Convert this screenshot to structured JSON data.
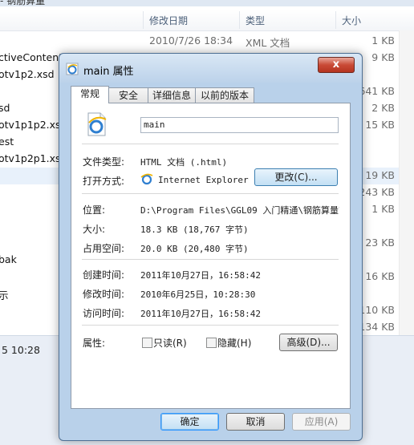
{
  "explorer": {
    "topbar_text": "- 钢筋算量",
    "columns": {
      "modified": "修改日期",
      "type": "类型",
      "size": "大小"
    },
    "files": [
      {
        "name": "",
        "modified": "2010/7/26 18:34",
        "type": "XML 文档",
        "size": "1 KB"
      },
      {
        "name": "ctiveContent",
        "modified": "",
        "type": "",
        "size": "9 KB"
      },
      {
        "name": "otv1p2.xsd",
        "modified": "",
        "type": "",
        "size": ""
      },
      {
        "name": "",
        "modified": "",
        "type": "",
        "size": "641 KB"
      },
      {
        "name": "sd",
        "modified": "",
        "type": "",
        "size": "2 KB"
      },
      {
        "name": "otv1p1p2.xsd",
        "modified": "",
        "type": "",
        "size": "15 KB"
      },
      {
        "name": "est",
        "modified": "",
        "type": "",
        "size": ""
      },
      {
        "name": "otv1p2p1.xsd",
        "modified": "",
        "type": "",
        "size": ""
      },
      {
        "name": "",
        "modified": "",
        "type": "",
        "size": "19 KB"
      },
      {
        "name": "",
        "modified": "",
        "type": "",
        "size": "243 KB"
      },
      {
        "name": "",
        "modified": "",
        "type": "",
        "size": "1 KB"
      },
      {
        "name": "",
        "modified": "",
        "type": "",
        "size": ""
      },
      {
        "name": "",
        "modified": "",
        "type": "",
        "size": "23 KB"
      },
      {
        "name": "bak",
        "modified": "",
        "type": "",
        "size": ""
      },
      {
        "name": "",
        "modified": "",
        "type": "",
        "size": "16 KB"
      },
      {
        "name": "示",
        "modified": "",
        "type": "",
        "size": ""
      },
      {
        "name": "",
        "modified": "",
        "type": "",
        "size": "110 KB"
      },
      {
        "name": "",
        "modified": "",
        "type": "",
        "size": "134 KB"
      }
    ],
    "status_text": "5 10:28"
  },
  "dialog": {
    "title": "main 属性",
    "close_label": "x",
    "tabs": [
      "常规",
      "安全",
      "详细信息",
      "以前的版本"
    ],
    "filename": "main",
    "file_type_label": "文件类型:",
    "file_type": "HTML 文档 (.html)",
    "opens_with_label": "打开方式:",
    "opens_with": "Internet Explorer",
    "change_button": "更改(C)...",
    "location_label": "位置:",
    "location": "D:\\Program Files\\GGL09 入门精通\\钢筋算量\\",
    "size_label": "大小:",
    "size": "18.3 KB (18,767 字节)",
    "size_on_disk_label": "占用空间:",
    "size_on_disk": "20.0 KB (20,480 字节)",
    "created_label": "创建时间:",
    "created": "2011年10月27日，16:58:42",
    "modified_label": "修改时间:",
    "modified": "2010年6月25日，10:28:30",
    "accessed_label": "访问时间:",
    "accessed": "2011年10月27日，16:58:42",
    "attributes_label": "属性:",
    "readonly_label": "只读(R)",
    "hidden_label": "隐藏(H)",
    "advanced_button": "高级(D)...",
    "ok_button": "确定",
    "cancel_button": "取消",
    "apply_button": "应用(A)"
  },
  "icons": {
    "ie": "internet-explorer-icon",
    "file": "html-file-icon"
  },
  "colors": {
    "dialog_frame": "#b9d1ea",
    "close": "#c94a36",
    "selection": "#e8f1fb"
  }
}
